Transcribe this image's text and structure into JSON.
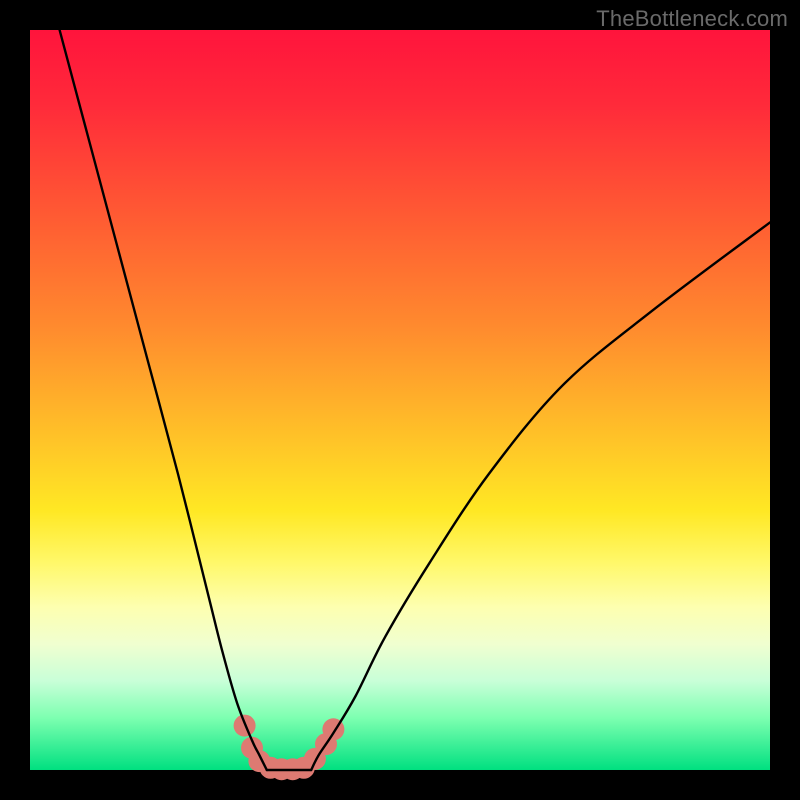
{
  "watermark": "TheBottleneck.com",
  "chart_data": {
    "type": "line",
    "title": "",
    "xlabel": "",
    "ylabel": "",
    "xlim": [
      0,
      100
    ],
    "ylim": [
      0,
      100
    ],
    "grid": false,
    "legend": false,
    "background_gradient_note": "vertical gradient red(top) → green(bottom) depicts bottleneck severity; green ≈ 0% bottleneck",
    "series": [
      {
        "name": "left-branch",
        "color": "#000000",
        "x": [
          4,
          8,
          12,
          16,
          20,
          24,
          26,
          28,
          30,
          31,
          32
        ],
        "y": [
          100,
          85,
          70,
          55,
          40,
          24,
          16,
          9,
          4,
          2,
          0
        ]
      },
      {
        "name": "right-branch",
        "color": "#000000",
        "x": [
          38,
          39,
          41,
          44,
          48,
          54,
          62,
          72,
          84,
          100
        ],
        "y": [
          0,
          2,
          5,
          10,
          18,
          28,
          40,
          52,
          62,
          74
        ]
      },
      {
        "name": "valley-floor",
        "color": "#000000",
        "x": [
          32,
          34,
          36,
          38
        ],
        "y": [
          0,
          0,
          0,
          0
        ]
      }
    ],
    "markers": {
      "name": "highlight-dots",
      "color": "#dd7a72",
      "radius_px": 11,
      "points": [
        {
          "x": 29,
          "y": 6
        },
        {
          "x": 30,
          "y": 3
        },
        {
          "x": 31,
          "y": 1.2
        },
        {
          "x": 32.5,
          "y": 0.3
        },
        {
          "x": 34,
          "y": 0.1
        },
        {
          "x": 35.5,
          "y": 0.1
        },
        {
          "x": 37,
          "y": 0.3
        },
        {
          "x": 38.5,
          "y": 1.5
        },
        {
          "x": 40,
          "y": 3.5
        },
        {
          "x": 41,
          "y": 5.5
        }
      ]
    }
  }
}
